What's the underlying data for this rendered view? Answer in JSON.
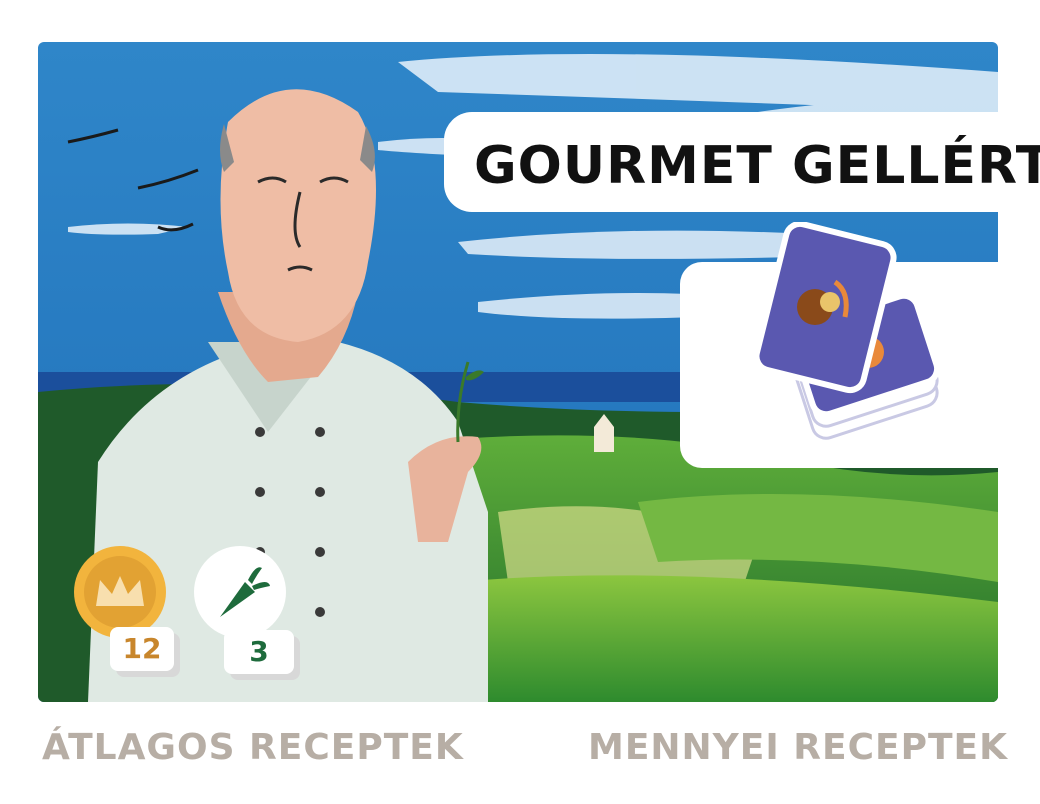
{
  "title": "GOURMET GELLÉRT",
  "tokens": {
    "crown": {
      "icon": "crown-icon",
      "count": "12",
      "color": "#c8862c"
    },
    "carrot": {
      "icon": "carrot-icon",
      "count": "3",
      "color": "#1e6b3c"
    }
  },
  "cards": {
    "icon": "recipe-card-stack-icon",
    "color": "#5a58b0"
  },
  "labels": {
    "left": "ÁTLAGOS RECEPTEK",
    "right": "MENNYEI RECEPTEK"
  }
}
